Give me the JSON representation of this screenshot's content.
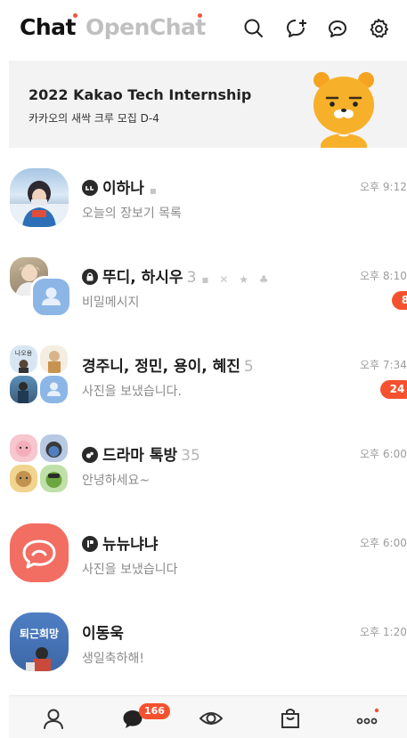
{
  "header": {
    "tabs": [
      {
        "label": "Chat",
        "active": true
      },
      {
        "label": "OpenChat",
        "active": false
      }
    ],
    "icons": [
      "search-icon",
      "new-chat-icon",
      "open-chat-icon",
      "settings-icon"
    ]
  },
  "banner": {
    "title": "2022 Kakao Tech Internship",
    "subtitle": "카카오의 새싹 크루 모집 D-4"
  },
  "chats": [
    {
      "name": "이하나",
      "count": "",
      "message": "오늘의 장보기 목록",
      "time": "오후 9:12",
      "unread": "",
      "icon": "chat-bubble-icon"
    },
    {
      "name": "뚜디, 하시우",
      "count": "3",
      "message": "비밀메시지",
      "time": "오후 8:10",
      "unread": "8",
      "icon": "lock-icon"
    },
    {
      "name": "경주니, 정민, 용이, 혜진",
      "count": "5",
      "message": "사진을 보냈습니다.",
      "time": "오후 7:34",
      "unread": "24",
      "icon": ""
    },
    {
      "name": "드라마 톡방",
      "count": "35",
      "message": "안녕하세요~",
      "time": "오후 6:00",
      "unread": "",
      "icon": "open-chat-badge-icon"
    },
    {
      "name": "뉴뉴냐냐",
      "count": "",
      "message": "사진을 보냈습니다",
      "time": "오후 6:00",
      "unread": "",
      "icon": "business-badge-icon"
    },
    {
      "name": "이동욱",
      "count": "",
      "message": "생일축하해!",
      "time": "오후 1:20",
      "unread": "",
      "icon": ""
    }
  ],
  "avatar_texts": {
    "group_tag": "나오용",
    "dongwook": "퇴근희망"
  },
  "tabbar": {
    "items": [
      "friends-icon",
      "chats-icon",
      "view-icon",
      "shopping-icon",
      "more-icon"
    ],
    "chat_badge": "166"
  },
  "colors": {
    "accent": "#f4522f",
    "banner_bg": "#f3f3f3",
    "inactive_tab": "#c0c0c0",
    "open_chat_bubble": "#f26d62"
  }
}
